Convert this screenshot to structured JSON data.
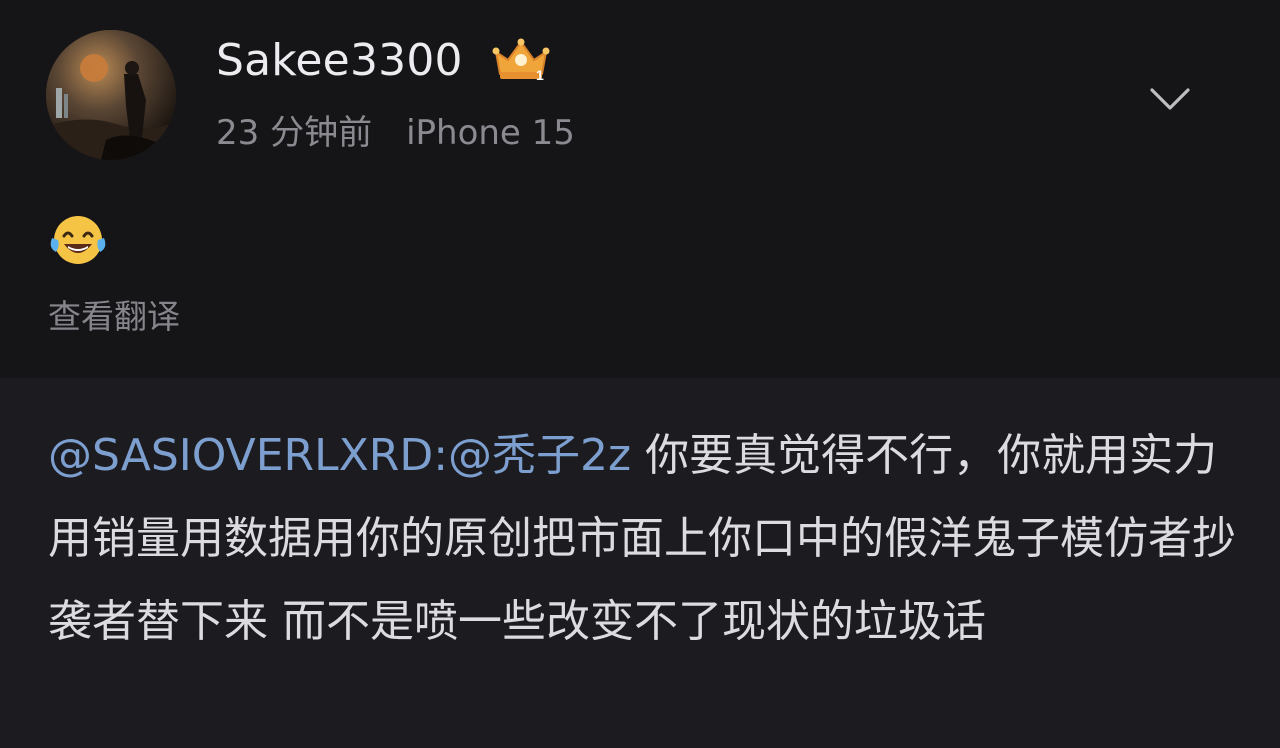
{
  "post": {
    "username": "Sakee3300",
    "badge_level": "1",
    "time_ago": "23 分钟前",
    "device": "iPhone 15",
    "emoji": "laughing-tears-emoji",
    "translate_label": "查看翻译"
  },
  "reply": {
    "mention_user": "@SASIOVERLXRD",
    "separator": ":",
    "mention_user_2": "@秃子2z",
    "text": " 你要真觉得不行，你就用实力用销量用数据用你的原创把市面上你口中的假洋鬼子模仿者抄袭者替下来 而不是喷一些改变不了现状的垃圾话"
  },
  "colors": {
    "background_top": "#151518",
    "background_bottom": "#1c1c20",
    "mention": "#7d9fcf",
    "text_primary": "#ececf0",
    "text_secondary": "#8a8a90",
    "badge_gold": "#f2b23a"
  },
  "icons": {
    "chevron": "chevron-down-icon",
    "badge": "crown-badge-icon"
  }
}
